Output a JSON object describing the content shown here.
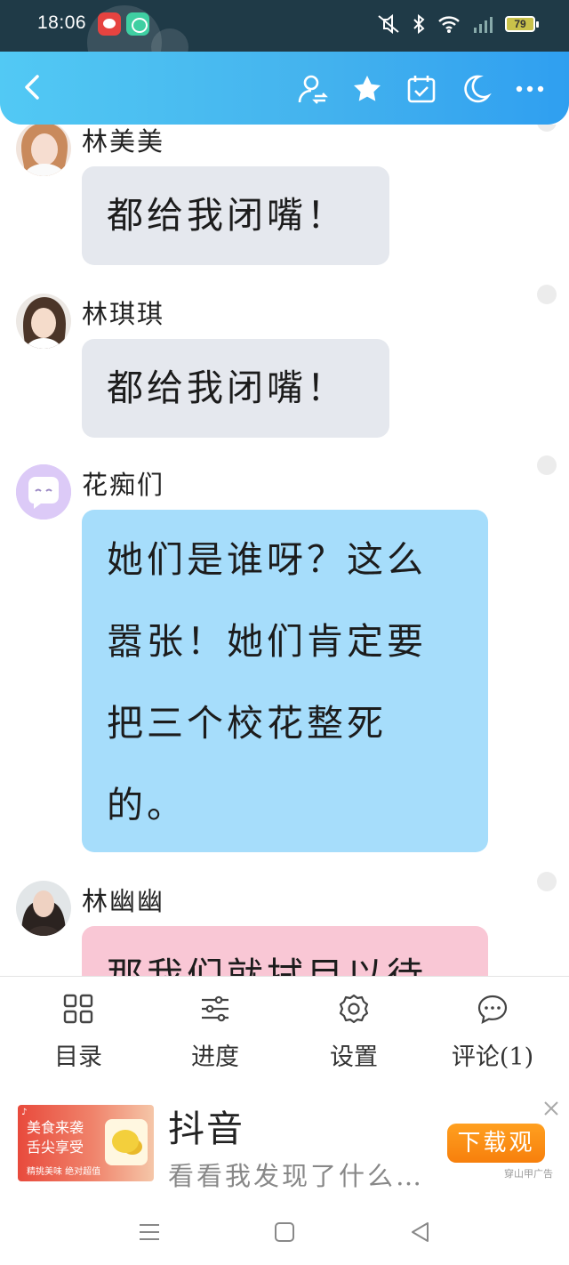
{
  "status_bar": {
    "time": "18:06",
    "battery": "79",
    "icons": [
      "weibo-icon",
      "chat-app-icon",
      "mute-icon",
      "bluetooth-icon",
      "wifi-icon",
      "signal-icon",
      "battery-icon"
    ]
  },
  "header": {
    "icons": [
      "back-arrow-icon",
      "character-switch-icon",
      "star-icon",
      "calendar-check-icon",
      "moon-icon",
      "more-dots-icon"
    ],
    "accent_colors": [
      "#52c9f4",
      "#2f9ff0"
    ]
  },
  "messages": [
    {
      "sender": "林美美",
      "text": "都给我闭嘴！",
      "bubble_color": "#e5e8ee"
    },
    {
      "sender": "林琪琪",
      "text": "都给我闭嘴！",
      "bubble_color": "#e5e8ee"
    },
    {
      "sender": "花痴们",
      "lines": [
        "她们是谁呀？这么",
        "嚣张！她们肯定要",
        "把三个校花整死",
        "的。"
      ],
      "bubble_color": "#a6ddfb"
    },
    {
      "sender": "林幽幽",
      "lines": [
        "那我们就拭目以待"
      ],
      "bubble_color": "#f9c7d5"
    }
  ],
  "menu": [
    {
      "label": "目录",
      "icon": "catalog-grid-icon"
    },
    {
      "label": "进度",
      "icon": "progress-sliders-icon"
    },
    {
      "label": "设置",
      "icon": "settings-gear-icon"
    },
    {
      "label": "评论(1)",
      "icon": "comment-bubble-icon"
    }
  ],
  "ad": {
    "thumb_line1": "美食来袭",
    "thumb_line2": "舌尖享受",
    "thumb_line3": "精挑美味 绝对超值",
    "title": "抖音",
    "description": "看看我发现了什么…",
    "button": "下载观",
    "label": "穿山甲广告"
  },
  "navbar": {
    "icons": [
      "menu-lines-icon",
      "home-square-icon",
      "back-triangle-icon"
    ]
  }
}
